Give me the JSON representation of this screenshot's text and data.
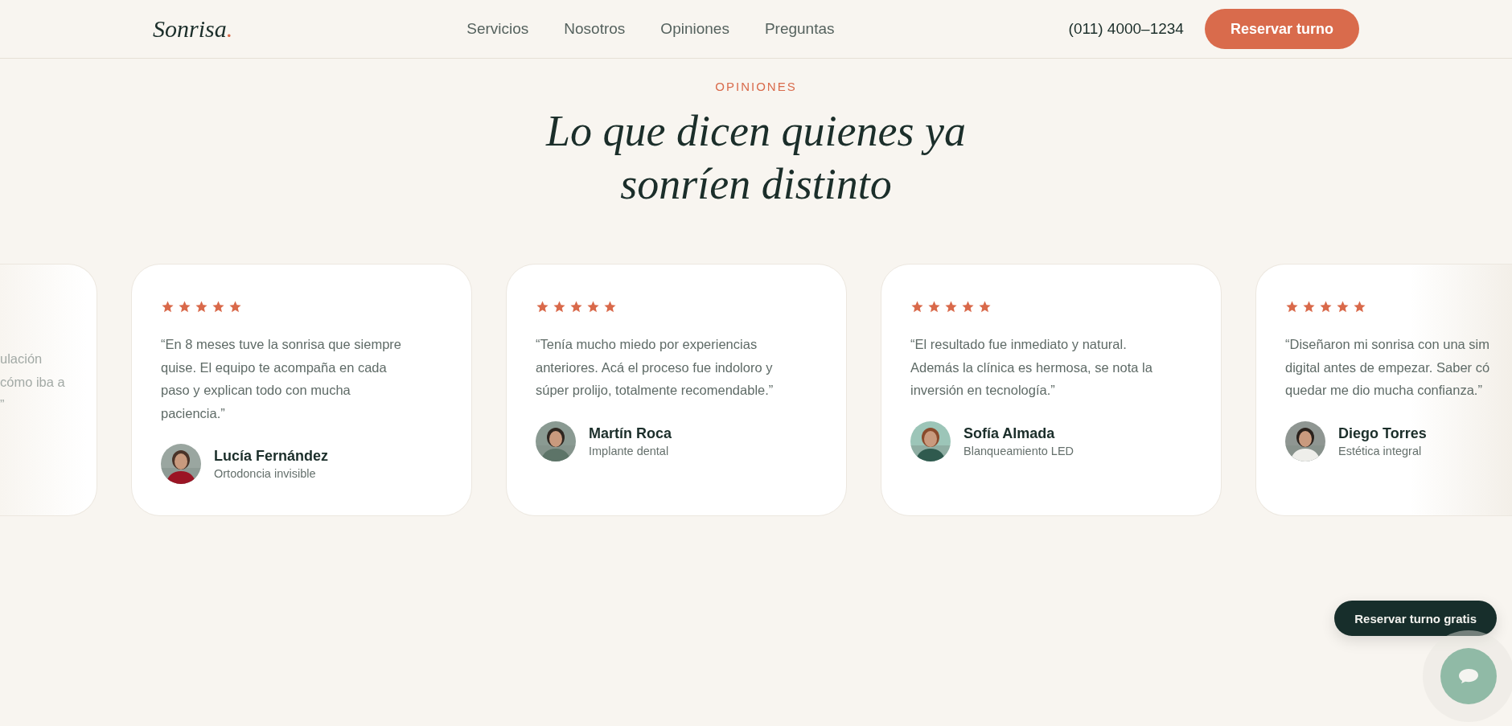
{
  "header": {
    "logo": {
      "text": "Sonrisa",
      "accent": "."
    },
    "nav": [
      {
        "label": "Servicios"
      },
      {
        "label": "Nosotros"
      },
      {
        "label": "Opiniones"
      },
      {
        "label": "Preguntas"
      }
    ],
    "phone": "(011) 4000–1234",
    "cta": "Reservar turno"
  },
  "section": {
    "eyebrow": "OPINIONES",
    "title_lines": [
      "Lo que dicen quienes ya",
      "sonríen distinto"
    ]
  },
  "cards": [
    {
      "kind": "partial_left",
      "quote_lines": [
        "ulación",
        "cómo iba a",
        "”"
      ]
    },
    {
      "kind": "full",
      "stars": 5,
      "quote_lines": [
        "“En 8 meses tuve la sonrisa que siempre",
        "quise. El equipo te acompaña en cada",
        "paso y explican todo con mucha",
        "paciencia.”"
      ],
      "name": "Lucía Fernández",
      "treatment": "Ortodoncia invisible",
      "avatar": {
        "kind": "picture"
      }
    },
    {
      "kind": "full",
      "stars": 5,
      "quote_lines": [
        "“Tenía mucho miedo por experiencias",
        "anteriores. Acá el proceso fue indoloro y",
        "súper prolijo, totalmente recomendable.”"
      ],
      "name": "Martín Roca",
      "treatment": "Implante dental",
      "avatar": {
        "kind": "picture"
      }
    },
    {
      "kind": "full",
      "stars": 5,
      "quote_lines": [
        "“El resultado fue inmediato y natural.",
        "Además la clínica es hermosa, se nota la",
        "inversión en tecnología.”"
      ],
      "name": "Sofía Almada",
      "treatment": "Blanqueamiento LED",
      "avatar": {
        "kind": "picture"
      }
    },
    {
      "kind": "partial_right",
      "stars": 5,
      "quote_lines": [
        "“Diseñaron mi sonrisa con una sim",
        "digital antes de empezar. Saber có",
        "quedar me dio mucha confianza.”"
      ],
      "name": "Diego Torres",
      "treatment": "Estética integral",
      "avatar": {
        "kind": "picture"
      }
    }
  ],
  "floating": {
    "cta": "Reservar turno gratis"
  }
}
